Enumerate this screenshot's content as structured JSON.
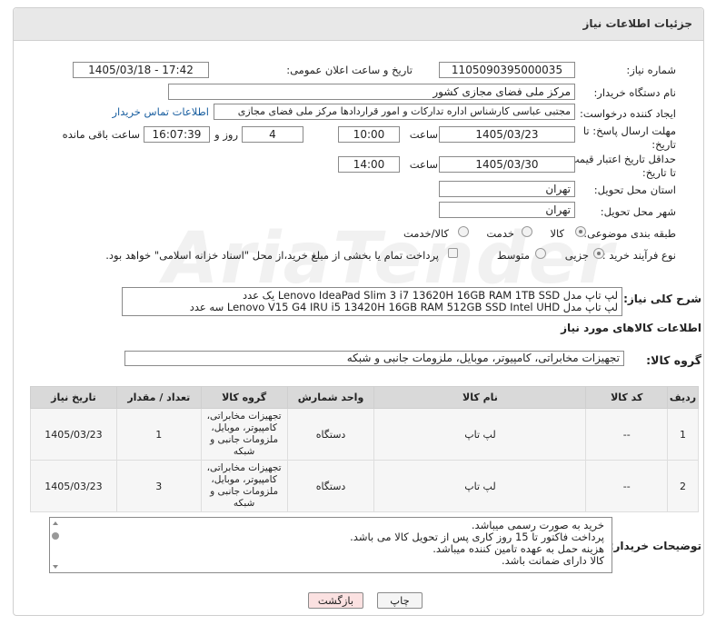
{
  "header": {
    "title": "جزئیات اطلاعات نیاز"
  },
  "form": {
    "need_number_label": "شماره نیاز:",
    "need_number": "1105090395000035",
    "announce_label": "تاریخ و ساعت اعلان عمومی:",
    "announce_value": "1405/03/18 - 17:42",
    "buyer_label": "نام دستگاه خریدار:",
    "buyer_value": "مرکز ملی فضای مجازی کشور",
    "creator_label": "ایجاد کننده درخواست:",
    "creator_value": "مجتبی عباسی کارشناس اداره تدارکات و امور قراردادها مرکز ملی فضای مجازی",
    "contact_link": "اطلاعات تماس خریدار",
    "deadline_label_1": "مهلت ارسال پاسخ: تا",
    "deadline_label_2": "تاریخ:",
    "deadline_date": "1405/03/23",
    "time_label": "ساعت",
    "deadline_time": "10:00",
    "days_value": "4",
    "days_label": "روز و",
    "remaining_time": "16:07:39",
    "remaining_label": "ساعت باقی مانده",
    "validity_label_1": "حداقل تاریخ اعتبار قیمت:",
    "validity_label_2": "تا تاریخ:",
    "validity_date": "1405/03/30",
    "validity_time": "14:00",
    "province_label": "استان محل تحویل:",
    "province_value": "تهران",
    "city_label": "شهر محل تحویل:",
    "city_value": "تهران",
    "category_label": "طبقه بندی موضوعی:",
    "category_options": [
      "کالا",
      "خدمت",
      "کالا/خدمت"
    ],
    "category_selected": "کالا",
    "purchase_type_label": "نوع فرآیند خرید :",
    "purchase_options": [
      "جزیی",
      "متوسط"
    ],
    "purchase_selected": "جزیی",
    "payment_note": "پرداخت تمام یا بخشی از مبلغ خرید،از محل \"اسناد خزانه اسلامی\" خواهد بود."
  },
  "description": {
    "label": "شرح کلی نیاز:",
    "line1": "لپ تاپ مدل Lenovo IdeaPad Slim 3 i7 13620H 16GB RAM 1TB SSD  یک عدد",
    "line2": "لپ تاپ مدل Lenovo V15 G4 IRU i5 13420H 16GB RAM 512GB SSD Intel UHD سه عدد"
  },
  "goods_info": {
    "title": "اطلاعات کالاهای مورد نیاز",
    "group_label": "گروه کالا:",
    "group_value": "تجهیزات مخابراتی، کامپیوتر، موبایل، ملزومات جانبی و شبکه"
  },
  "table": {
    "headers": [
      "ردیف",
      "کد کالا",
      "نام کالا",
      "واحد شمارش",
      "گروه کالا",
      "تعداد / مقدار",
      "تاریخ نیاز"
    ],
    "rows": [
      {
        "index": "1",
        "code": "--",
        "name": "لپ تاپ",
        "unit": "دستگاه",
        "group": "تجهیزات مخابراتی، کامپیوتر، موبایل، ملزومات جانبی و شبکه",
        "qty": "1",
        "date": "1405/03/23"
      },
      {
        "index": "2",
        "code": "--",
        "name": "لپ تاپ",
        "unit": "دستگاه",
        "group": "تجهیزات مخابراتی، کامپیوتر، موبایل، ملزومات جانبی و شبکه",
        "qty": "3",
        "date": "1405/03/23"
      }
    ]
  },
  "buyer_notes": {
    "label": "توضیحات خریدار:",
    "lines": [
      "خرید به صورت رسمی میباشد.",
      "پرداخت فاکتور تا 15 روز کاری پس از تحویل کالا می باشد.",
      "هزینه حمل به عهده تامین کننده میباشد.",
      "کالا دارای ضمانت باشد."
    ]
  },
  "buttons": {
    "print": "چاپ",
    "back": "بازگشت"
  },
  "colors": {
    "header_bg": "#e8e8e8",
    "table_header_bg": "#d9d9d9",
    "link": "#1a5fa0",
    "back_button_bg": "#fbe1e1"
  }
}
